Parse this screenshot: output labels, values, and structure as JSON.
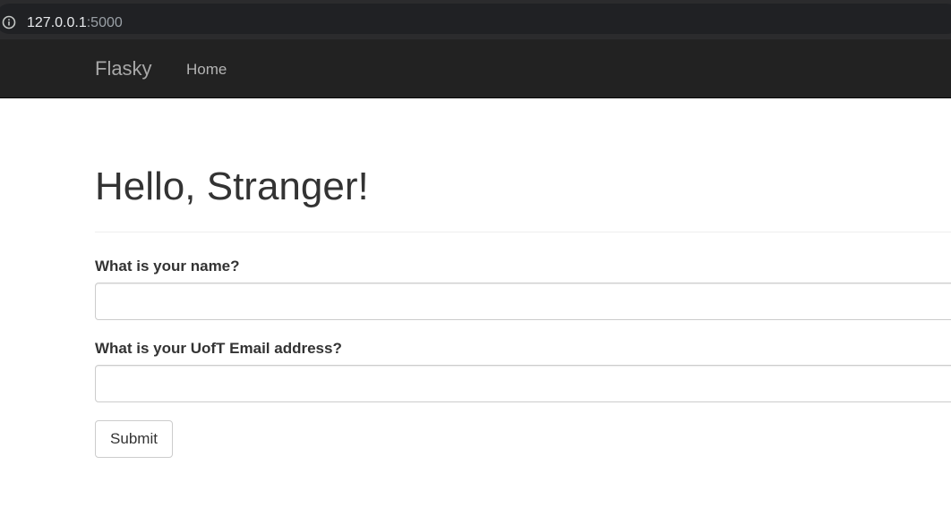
{
  "browser": {
    "url_host": "127.0.0.1",
    "url_port": ":5000",
    "info_icon": "info-circle-icon"
  },
  "navbar": {
    "brand": "Flasky",
    "items": [
      {
        "label": "Home"
      }
    ]
  },
  "main": {
    "title": "Hello, Stranger!",
    "form": {
      "name_label": "What is your name?",
      "name_value": "",
      "email_label": "What is your UofT Email address?",
      "email_value": "",
      "submit_label": "Submit"
    }
  },
  "colors": {
    "navbar_bg": "#222222",
    "browser_bar_bg": "#2b2b2d",
    "text": "#333333"
  }
}
